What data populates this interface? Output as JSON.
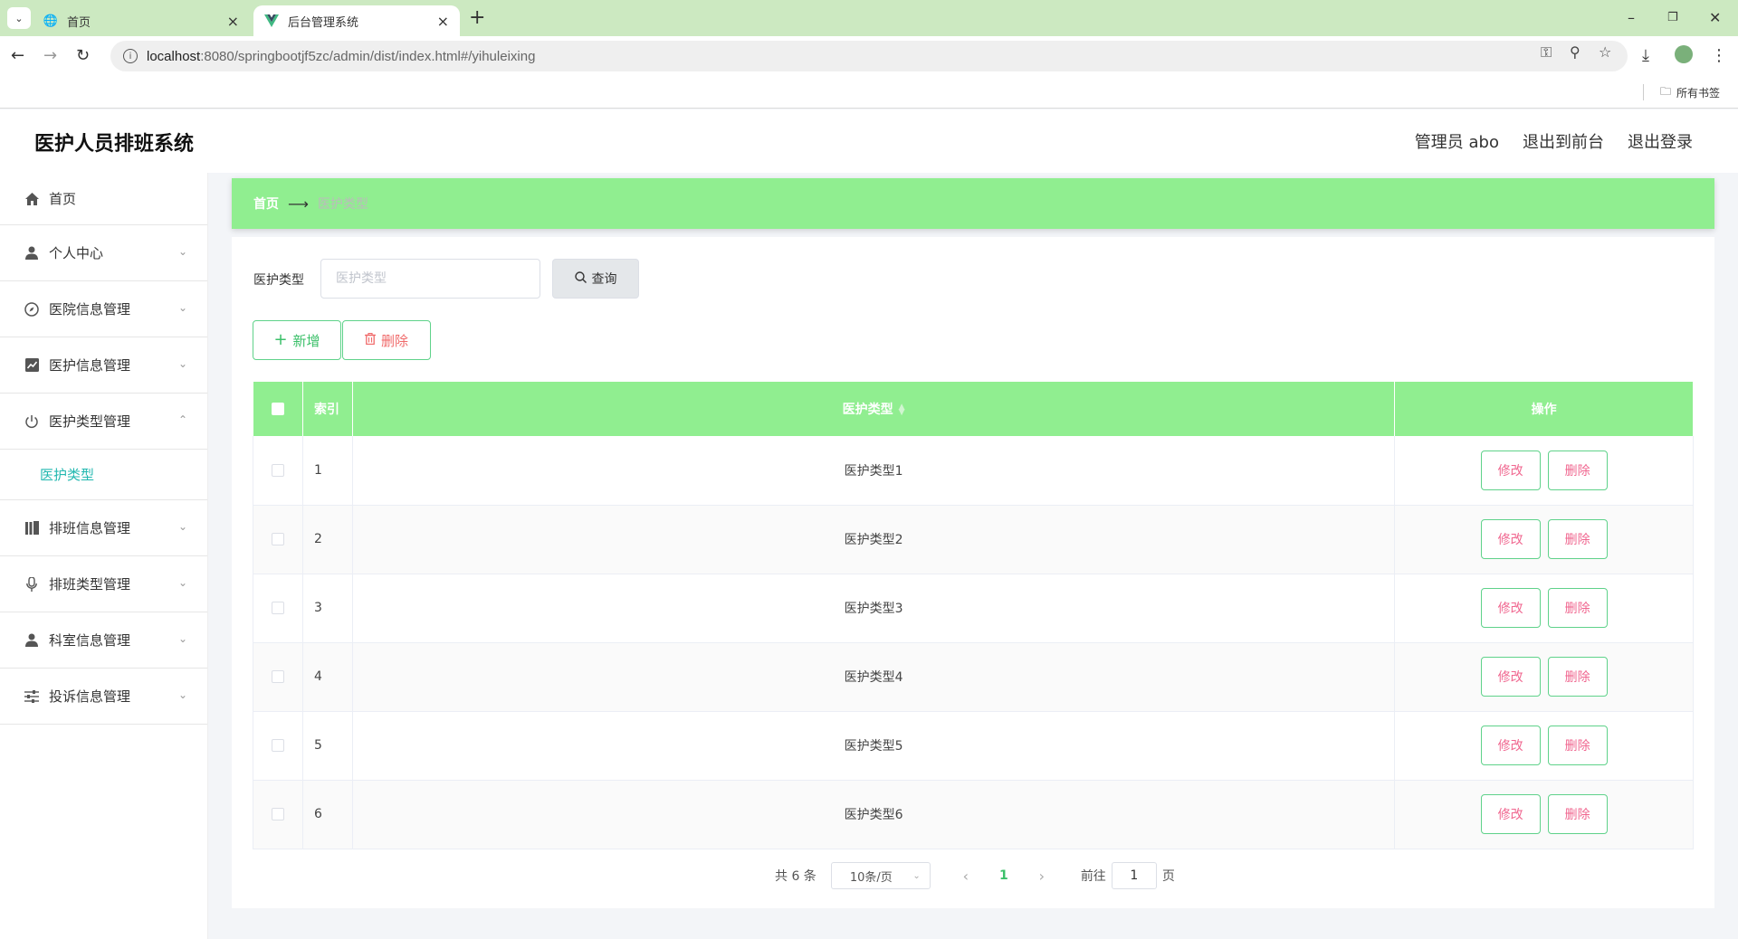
{
  "browser": {
    "tabs": [
      {
        "label": "首页",
        "icon": "globe-icon"
      },
      {
        "label": "后台管理系统",
        "icon": "vue-logo-icon"
      }
    ],
    "url_host": "localhost",
    "url_rest": ":8080/springbootjf5zc/admin/dist/index.html#/yihuleixing",
    "bookmarks_label": "所有书签"
  },
  "app": {
    "title": "医护人员排班系统",
    "user": "管理员 abo",
    "to_front": "退出到前台",
    "logout": "退出登录"
  },
  "sidebar": {
    "items": [
      {
        "label": "首页",
        "icon": "home-icon"
      },
      {
        "label": "个人中心",
        "icon": "user-icon"
      },
      {
        "label": "医院信息管理",
        "icon": "compass-icon"
      },
      {
        "label": "医护信息管理",
        "icon": "chart-icon"
      },
      {
        "label": "医护类型管理",
        "icon": "power-icon"
      },
      {
        "label": "排班信息管理",
        "icon": "library-icon"
      },
      {
        "label": "排班类型管理",
        "icon": "microphone-icon"
      },
      {
        "label": "科室信息管理",
        "icon": "user-icon"
      },
      {
        "label": "投诉信息管理",
        "icon": "sliders-icon"
      }
    ],
    "sub_item": "医护类型"
  },
  "breadcrumb": {
    "home": "首页",
    "current": "医护类型"
  },
  "search": {
    "label": "医护类型",
    "placeholder": "医护类型",
    "button": "查询"
  },
  "actions": {
    "add": "新增",
    "delete": "删除"
  },
  "table": {
    "headers": {
      "index": "索引",
      "type": "医护类型",
      "ops": "操作"
    },
    "rows": [
      {
        "index": "1",
        "type": "医护类型1"
      },
      {
        "index": "2",
        "type": "医护类型2"
      },
      {
        "index": "3",
        "type": "医护类型3"
      },
      {
        "index": "4",
        "type": "医护类型4"
      },
      {
        "index": "5",
        "type": "医护类型5"
      },
      {
        "index": "6",
        "type": "医护类型6"
      }
    ],
    "edit_label": "修改",
    "delete_label": "删除"
  },
  "pagination": {
    "total": "共 6 条",
    "page_size": "10条/页",
    "current_page": "1",
    "goto_label": "前往",
    "goto_value": "1",
    "page_unit": "页"
  },
  "colors": {
    "accent_green": "#90ee90",
    "link_teal": "#23b8b0",
    "danger_pink": "#f0668f"
  }
}
